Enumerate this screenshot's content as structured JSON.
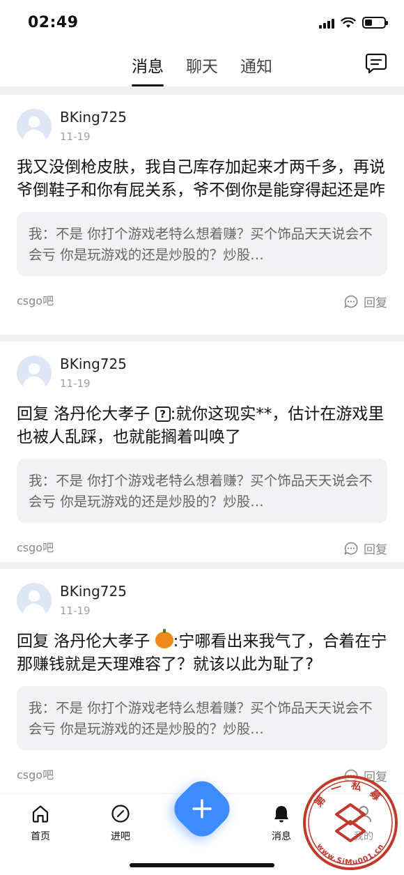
{
  "status_bar": {
    "time": "02:49",
    "battery_level": 0.4
  },
  "top_nav": {
    "tabs": [
      {
        "label": "消息",
        "active": true
      },
      {
        "label": "聊天",
        "active": false
      },
      {
        "label": "通知",
        "active": false
      }
    ],
    "chat_icon": "chat-bubble-icon"
  },
  "cards": [
    {
      "username": "BKing725",
      "date": "11-19",
      "text": "我又没倒枪皮肤，我自己库存加起来才两千多，再说爷倒鞋子和你有屁关系，爷不倒你是能穿得起还是咋",
      "quote": "我：不是 你打个游戏老特么想着赚？买个饰品天天说会不会亏 你是玩游戏的还是炒股的？炒股…",
      "bar": "csgo吧",
      "reply_label": "回复"
    },
    {
      "username": "BKing725",
      "date": "11-19",
      "text_prefix": "回复 洛丹伦大孝子",
      "emoji": "question-box-emoji",
      "text_suffix": ":就你这现实**，估计在游戏里也被人乱踩，也就能搁着叫唤了",
      "quote": "我：不是 你打个游戏老特么想着赚？买个饰品天天说会不会亏 你是玩游戏的还是炒股的？炒股…",
      "bar": "csgo吧",
      "reply_label": "回复"
    },
    {
      "username": "BKing725",
      "date": "11-19",
      "text_prefix": "回复 洛丹伦大孝子",
      "emoji": "pumpkin-emoji",
      "text_suffix": ":宁哪看出来我气了，合着在宁那赚钱就是天理难容了？就该以此为耻了?",
      "quote": "我：不是 你打个游戏老特么想着赚？买个饰品天天说会不会亏 你是玩游戏的还是炒股的？炒股…",
      "bar": "csgo吧",
      "reply_label": "回复"
    }
  ],
  "bottom_nav": {
    "items": [
      {
        "label": "首页",
        "icon": "home-icon"
      },
      {
        "label": "进吧",
        "icon": "compass-icon"
      },
      {
        "label": "消息",
        "icon": "bell-icon"
      },
      {
        "label": "我的",
        "icon": "profile-icon"
      }
    ],
    "fab_icon": "plus-icon"
  },
  "watermark": {
    "top_text": "第一私募",
    "bottom_text": "www.SiMu001.cn"
  },
  "colors": {
    "accent": "#3d8bff",
    "quote_bg": "#f2f2f4",
    "divider": "#f0f0f2",
    "watermark": "#c0392b"
  }
}
